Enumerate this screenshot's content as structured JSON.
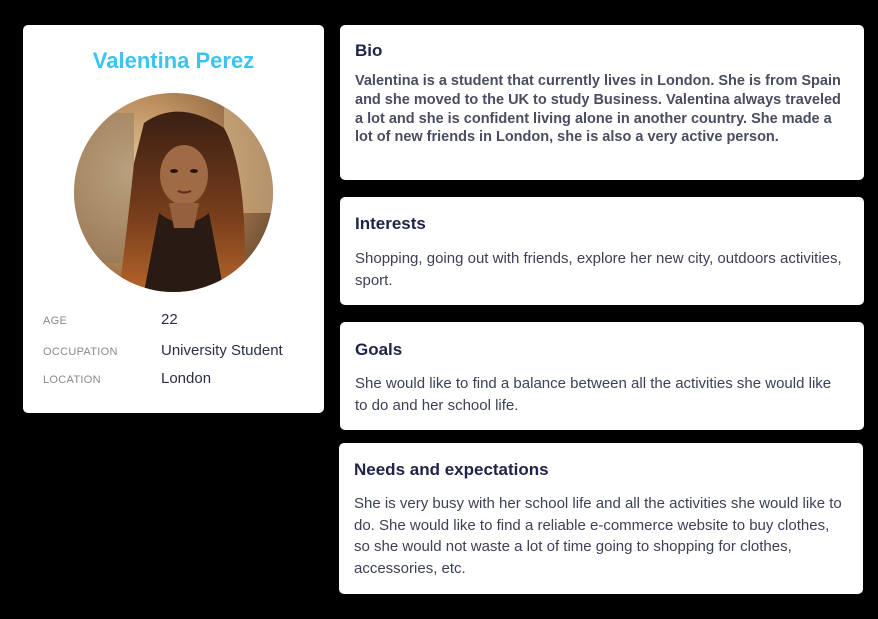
{
  "profile": {
    "name": "Valentina Perez",
    "avatar_alt": "Profile photo",
    "fields": [
      {
        "label": "AGE",
        "value": "22"
      },
      {
        "label": "OCCUPATION",
        "value": "University Student"
      },
      {
        "label": "LOCATION",
        "value": "London"
      }
    ]
  },
  "sections": {
    "bio": {
      "title": "Bio",
      "body": "Valentina is a student that currently lives in London. She is from Spain and she moved to the UK to study Business. Valentina always traveled a lot and she is confident living alone in another country. She made a lot of new friends in London, she is also a very active person."
    },
    "interests": {
      "title": "Interests",
      "body": "Shopping, going out with friends, explore her new city, outdoors activities, sport."
    },
    "goals": {
      "title": "Goals",
      "body": "She would like to find a balance between all the activities she would like to do and her school life."
    },
    "needs": {
      "title": "Needs and expectations",
      "body": "She is very busy with her school life and all the activities she would like to do. She would like to find a reliable e-commerce website to buy clothes, so she would not waste a lot of time going to shopping for clothes, accessories, etc."
    }
  },
  "colors": {
    "background": "#000000",
    "card": "#ffffff",
    "name_accent": "#3cc3f0",
    "heading": "#1f2347",
    "label": "#8a8a8a"
  }
}
